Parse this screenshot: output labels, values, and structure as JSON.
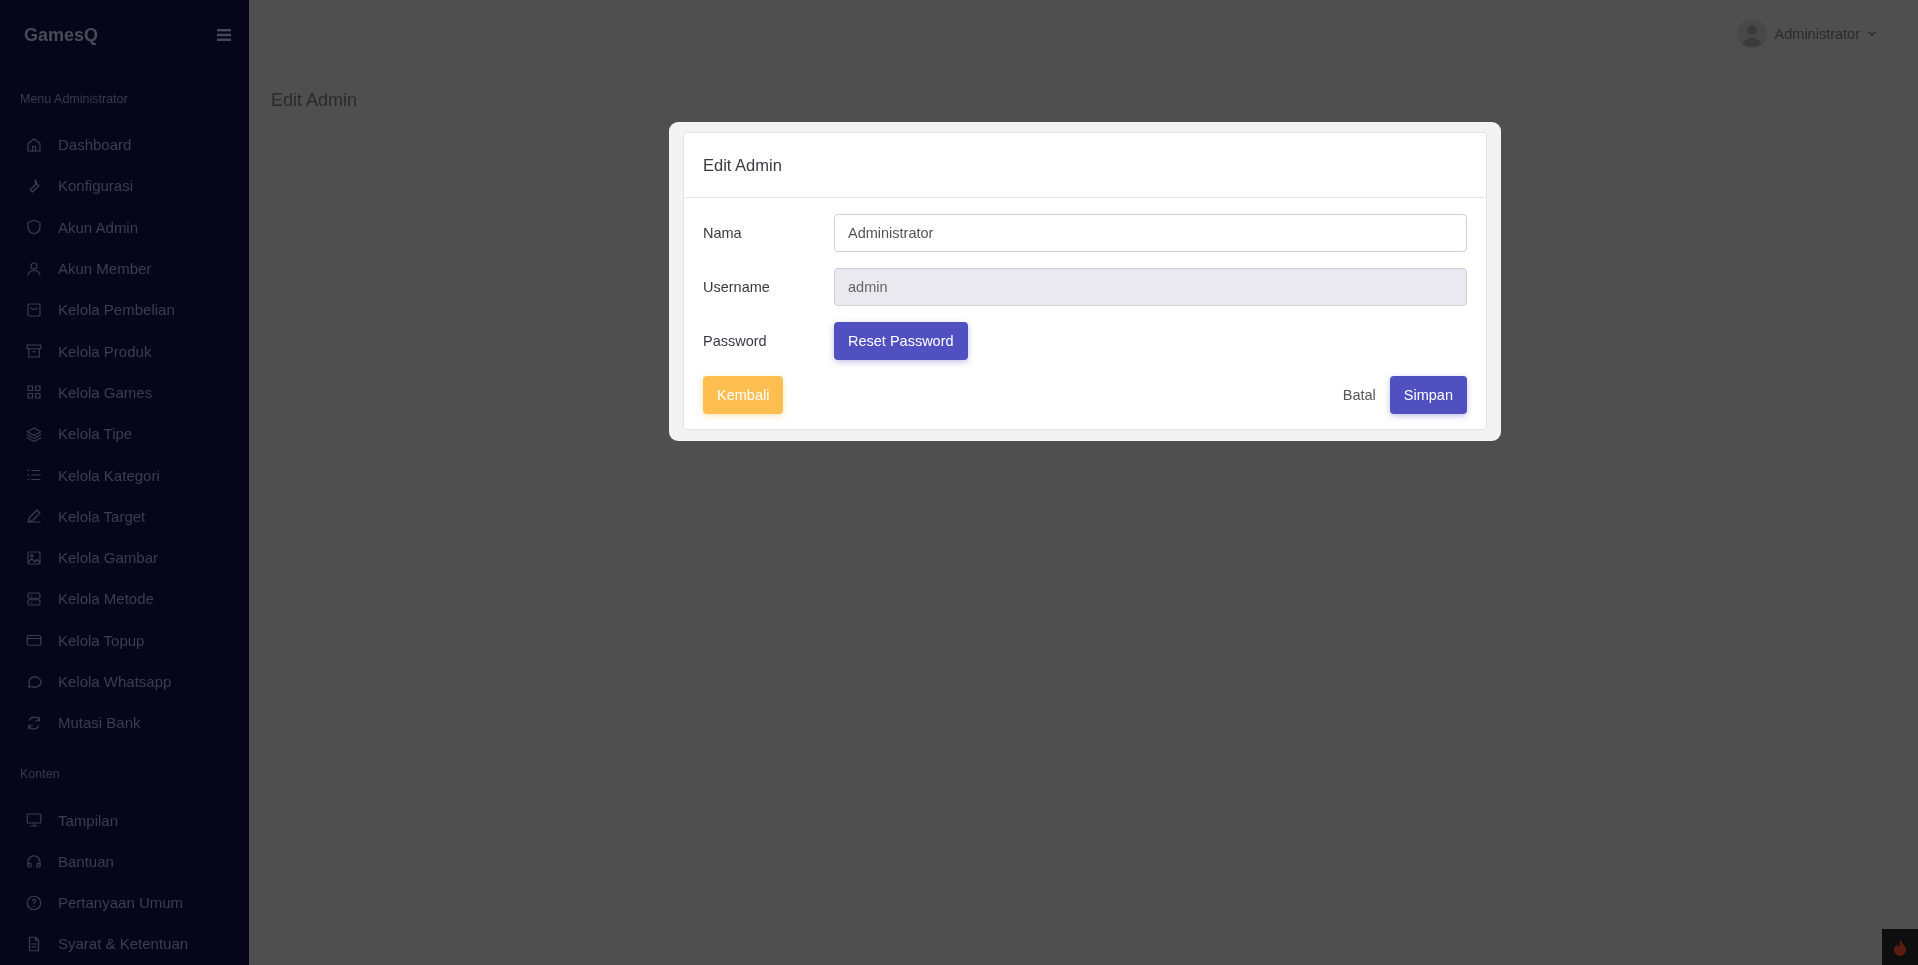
{
  "brand": "GamesQ",
  "sidebar": {
    "sections": [
      {
        "title": "Menu Administrator",
        "items": [
          {
            "label": "Dashboard"
          },
          {
            "label": "Konfigurasi"
          },
          {
            "label": "Akun Admin"
          },
          {
            "label": "Akun Member"
          },
          {
            "label": "Kelola Pembelian"
          },
          {
            "label": "Kelola Produk"
          },
          {
            "label": "Kelola Games"
          },
          {
            "label": "Kelola Tipe"
          },
          {
            "label": "Kelola Kategori"
          },
          {
            "label": "Kelola Target"
          },
          {
            "label": "Kelola Gambar"
          },
          {
            "label": "Kelola Metode"
          },
          {
            "label": "Kelola Topup"
          },
          {
            "label": "Kelola Whatsapp"
          },
          {
            "label": "Mutasi Bank"
          }
        ]
      },
      {
        "title": "Konten",
        "items": [
          {
            "label": "Tampilan"
          },
          {
            "label": "Bantuan"
          },
          {
            "label": "Pertanyaan Umum"
          },
          {
            "label": "Syarat & Ketentuan"
          }
        ]
      }
    ]
  },
  "user_menu": {
    "name": "Administrator"
  },
  "page_title": "Edit Admin",
  "modal": {
    "title": "Edit Admin",
    "fields": [
      {
        "kind": "input",
        "label": "Nama",
        "value": "Administrator",
        "disabled": false
      },
      {
        "kind": "input",
        "label": "Username",
        "value": "admin",
        "disabled": true
      },
      {
        "kind": "button",
        "label": "Password",
        "button": "Reset Password"
      }
    ],
    "back_button": "Kembali",
    "cancel_link": "Batal",
    "save_button": "Simpan"
  }
}
